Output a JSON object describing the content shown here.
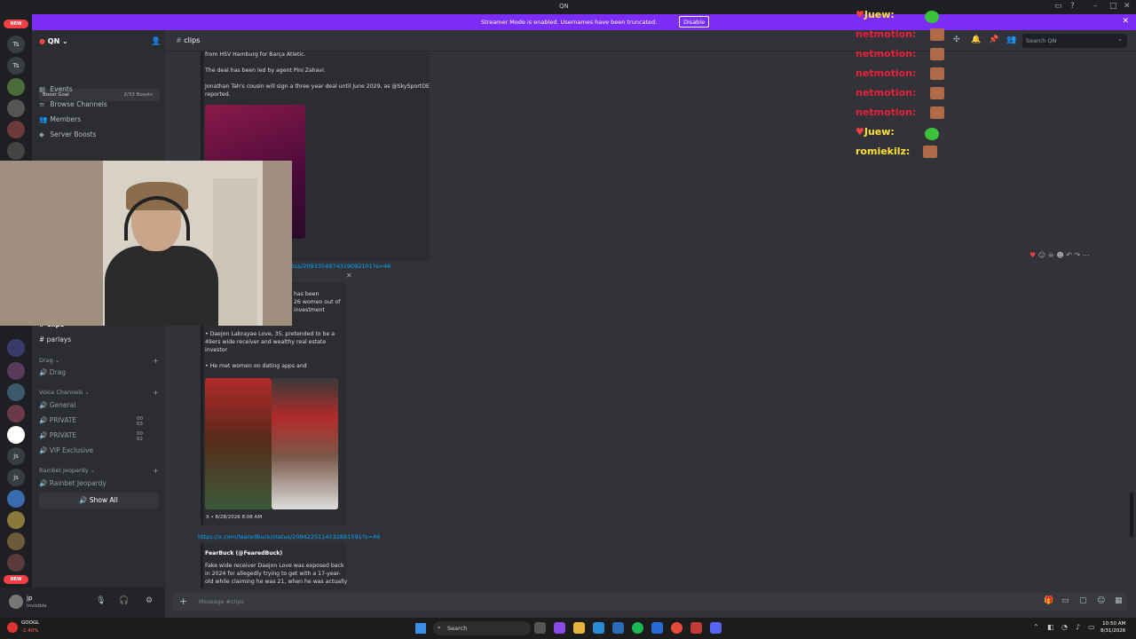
{
  "window": {
    "title": "QN"
  },
  "banner": {
    "message": "Streamer Mode is enabled. Usernames have been truncated.",
    "disable_label": "Disable"
  },
  "rail": {
    "new_badge": "NEW",
    "servers": [
      "Ts",
      "Ts",
      "js",
      "js"
    ],
    "new_badge_bottom": "NEW"
  },
  "sidebar": {
    "server_name": "QN",
    "boost_goal_label": "Boost Goal",
    "boost_count": "2/33 Boosts",
    "nav": [
      "Events",
      "Browse Channels",
      "Members",
      "Server Boosts"
    ],
    "channels_visible": [
      "clips",
      "parlays"
    ],
    "category_drag": "Drag",
    "drag_channel": "Drag",
    "category_voice": "Voice Channels",
    "voice_channels": [
      {
        "name": "General",
        "count": ""
      },
      {
        "name": "PRIVATE",
        "count": "00  03"
      },
      {
        "name": "PRIVATE",
        "count": "00  02"
      },
      {
        "name": "VIP Exclusive",
        "count": ""
      }
    ],
    "category_rainbet": "Rainbet Jeopardy",
    "rainbet_channel": "Rainbet Jeopardy",
    "show_all": "Show All"
  },
  "user": {
    "name": "jp",
    "status": "Invisible"
  },
  "channel": {
    "name": "clips",
    "search_placeholder": "Search QN",
    "message_placeholder": "Message #clips"
  },
  "messages": {
    "m1_lines": [
      "from HSV Hamburg for Barça Atletic.",
      "The deal has been led by agent Pini Zahavi.",
      "Jonathan Tah's cousin will sign a three year deal until June 2029, as @SkySportDE",
      "reported."
    ],
    "m2_link": "tus/2093354974319092101?s=46",
    "m2_lines": [
      "has been",
      "26 women out of",
      "investment"
    ],
    "m2_bullets": [
      "• Daejon Labrayae Love, 35, pretended to be a",
      "49ers wide receiver and wealthy real estate",
      "investor",
      "• He met women on dating apps and"
    ],
    "m2_footer": "X • 8/28/2026 8:08 AM",
    "m3_link": "https://x.com/fearedbuck/status/2094225114132881591?s=46",
    "m3_author": "FearBuck (@FearedBuck)",
    "m3_lines": [
      "Fake wide receiver Daejon Love was exposed back",
      "in 2024 for allegedly trying to get with a 17-year-",
      "old while claiming he was 21, when he was actually"
    ]
  },
  "stream_chat": [
    {
      "user": "Juew:",
      "color": "#ffe03a"
    },
    {
      "user": "netmotion:",
      "color": "#e8203c"
    },
    {
      "user": "netmotion:",
      "color": "#e8203c"
    },
    {
      "user": "netmotion:",
      "color": "#e8203c"
    },
    {
      "user": "netmotion:",
      "color": "#e8203c"
    },
    {
      "user": "netmotion:",
      "color": "#e8203c"
    },
    {
      "user": "Juew:",
      "color": "#ffe03a"
    },
    {
      "user": "romiekilz:",
      "color": "#ffe03a"
    }
  ],
  "taskbar": {
    "stock_name": "GOOGL",
    "stock_change": "-2.40%",
    "search_label": "Search",
    "time": "10:50 AM",
    "date": "8/31/2026"
  },
  "colors": {
    "accent": "#7b2cf5",
    "link": "#00a8fc",
    "background": "#313338"
  }
}
